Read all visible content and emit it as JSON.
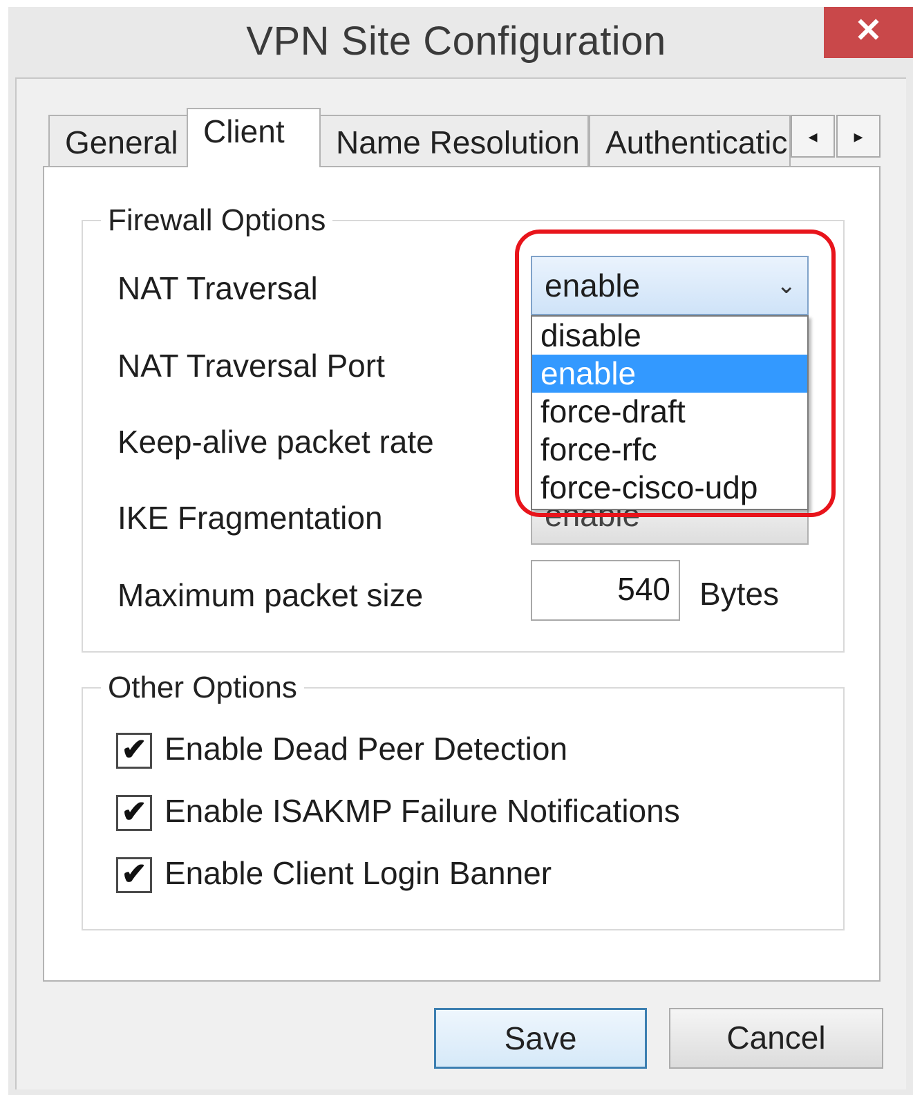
{
  "window": {
    "title": "VPN Site Configuration",
    "close_glyph": "✕"
  },
  "tabs": [
    {
      "label": "General"
    },
    {
      "label": "Client"
    },
    {
      "label": "Name Resolution"
    },
    {
      "label": "Authenticatic"
    }
  ],
  "tab_scroll": {
    "left_glyph": "◂",
    "right_glyph": "▸"
  },
  "firewall": {
    "legend": "Firewall Options",
    "nat_traversal_label": "NAT Traversal",
    "nat_traversal_value": "enable",
    "nat_traversal_port_label": "NAT Traversal Port",
    "keepalive_label": "Keep-alive packet rate",
    "ike_fragmentation_label": "IKE Fragmentation",
    "ike_fragmentation_value": "enable",
    "max_packet_label": "Maximum packet size",
    "max_packet_value": "540",
    "max_packet_unit": "Bytes",
    "chevron_glyph": "⌄"
  },
  "dropdown": {
    "options": [
      "disable",
      "enable",
      "force-draft",
      "force-rfc",
      "force-cisco-udp"
    ],
    "selected_index": 1
  },
  "other": {
    "legend": "Other Options",
    "checkboxes": [
      {
        "label": "Enable Dead Peer Detection",
        "checked": true
      },
      {
        "label": "Enable ISAKMP Failure Notifications",
        "checked": true
      },
      {
        "label": "Enable Client Login Banner",
        "checked": true
      }
    ],
    "check_glyph": "✔"
  },
  "buttons": {
    "save": "Save",
    "cancel": "Cancel"
  },
  "colors": {
    "highlight_ring": "#e8141b",
    "selection": "#3399ff",
    "close": "#c9484a"
  }
}
